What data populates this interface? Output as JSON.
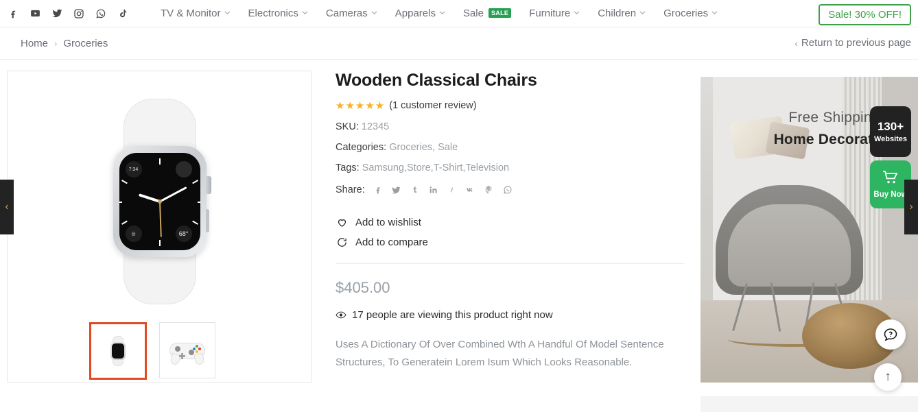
{
  "topbar": {
    "social_icons": [
      {
        "name": "facebook-icon",
        "label": "Facebook"
      },
      {
        "name": "youtube-icon",
        "label": "YouTube"
      },
      {
        "name": "twitter-icon",
        "label": "Twitter"
      },
      {
        "name": "instagram-icon",
        "label": "Instagram"
      },
      {
        "name": "whatsapp-icon",
        "label": "WhatsApp"
      },
      {
        "name": "tiktok-icon",
        "label": "TikTok"
      }
    ],
    "nav": [
      {
        "label": "TV & Monitor",
        "has_dropdown": true,
        "badge": ""
      },
      {
        "label": "Electronics",
        "has_dropdown": true,
        "badge": ""
      },
      {
        "label": "Cameras",
        "has_dropdown": true,
        "badge": ""
      },
      {
        "label": "Apparels",
        "has_dropdown": true,
        "badge": ""
      },
      {
        "label": "Sale",
        "has_dropdown": false,
        "badge": "SALE"
      },
      {
        "label": "Furniture",
        "has_dropdown": true,
        "badge": ""
      },
      {
        "label": "Children",
        "has_dropdown": true,
        "badge": ""
      },
      {
        "label": "Groceries",
        "has_dropdown": true,
        "badge": ""
      }
    ],
    "cta_label": "Sale! 30% OFF!",
    "cta_color": "#3ea14a",
    "badge_color": "#27a052"
  },
  "breadcrumb": {
    "items": [
      "Home",
      "Groceries"
    ],
    "separator": "›",
    "return_label": "Return to previous page",
    "return_chevron": "‹"
  },
  "gallery": {
    "main_image_alt": "Apple Watch with white sport band",
    "watch_temperature": "68°",
    "watch_time_label": "7:34",
    "thumbnails": [
      {
        "alt": "Apple Watch thumbnail",
        "selected": true
      },
      {
        "alt": "Game controller thumbnail",
        "selected": false
      }
    ],
    "selected_border_color": "#e04a1f"
  },
  "product": {
    "title": "Wooden Classical Chairs",
    "stars": "★★★★★",
    "star_color": "#f6b11f",
    "rating_value": 5,
    "review_text": "(1 customer review)",
    "sku_label": "SKU:",
    "sku_value": "12345",
    "categories_label": "Categories:",
    "categories": [
      "Groceries",
      "Sale"
    ],
    "tags_label": "Tags:",
    "tags": [
      "Samsung",
      "Store",
      "T-Shirt",
      "Television"
    ],
    "share_label": "Share:",
    "share_icons": [
      {
        "name": "facebook-share-icon",
        "label": "Facebook"
      },
      {
        "name": "twitter-share-icon",
        "label": "Twitter"
      },
      {
        "name": "tumblr-share-icon",
        "label": "Tumblr"
      },
      {
        "name": "linkedin-share-icon",
        "label": "LinkedIn"
      },
      {
        "name": "skype-share-icon",
        "label": "Skype"
      },
      {
        "name": "vk-share-icon",
        "label": "VK"
      },
      {
        "name": "pinterest-share-icon",
        "label": "Pinterest"
      },
      {
        "name": "whatsapp-share-icon",
        "label": "WhatsApp"
      }
    ],
    "wishlist_label": "Add to wishlist",
    "compare_label": "Add to compare",
    "price": "$405.00",
    "viewers_text": "17 people are viewing this product right now",
    "description": "Uses A Dictionary Of Over Combined Wth A Handful Of Model Sentence Structures, To Generatein Lorem Isum Which Looks Reasonable."
  },
  "promo": {
    "line1": "Free Shipping",
    "line2": "Home Decoration",
    "badge_number": "130+",
    "badge_word": "Websites",
    "buy_now_label": "Buy Now",
    "buy_now_color": "#2eb561",
    "help_icon_glyph": "?",
    "scroll_top_glyph": "↑"
  },
  "carousel": {
    "prev_glyph": "‹",
    "next_glyph": "›",
    "arrow_color": "#d8a43a"
  }
}
